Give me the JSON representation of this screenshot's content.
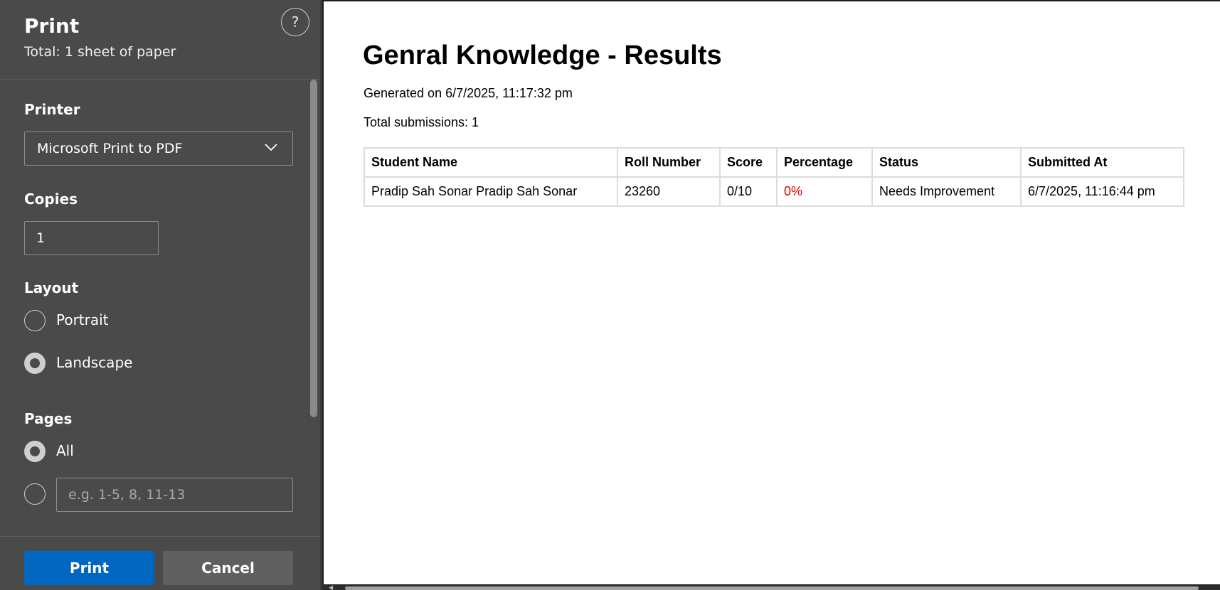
{
  "panel": {
    "title": "Print",
    "subtitle": "Total: 1 sheet of paper",
    "help_label": "?",
    "printer_label": "Printer",
    "printer_value": "Microsoft Print to PDF",
    "copies_label": "Copies",
    "copies_value": "1",
    "layout_label": "Layout",
    "layout_options": [
      {
        "label": "Portrait",
        "selected": false
      },
      {
        "label": "Landscape",
        "selected": true
      }
    ],
    "pages_label": "Pages",
    "pages_all_label": "All",
    "pages_placeholder": "e.g. 1-5, 8, 11-13",
    "print_button": "Print",
    "cancel_button": "Cancel"
  },
  "document": {
    "title": "Genral Knowledge - Results",
    "generated": "Generated on 6/7/2025, 11:17:32 pm",
    "total": "Total submissions: 1",
    "table": {
      "headers": [
        "Student Name",
        "Roll Number",
        "Score",
        "Percentage",
        "Status",
        "Submitted At"
      ],
      "rows": [
        [
          "Pradip Sah Sonar Pradip Sah Sonar",
          "23260",
          "0/10",
          "0%",
          "Needs Improvement",
          "6/7/2025, 11:16:44 pm"
        ]
      ]
    }
  },
  "colors": {
    "panel_bg": "#4a4a4a",
    "primary_button": "#0067c0",
    "percentage_text": "#e00000"
  },
  "icons": {
    "help": "question-mark-circle-icon",
    "dropdown": "chevron-down-icon"
  }
}
